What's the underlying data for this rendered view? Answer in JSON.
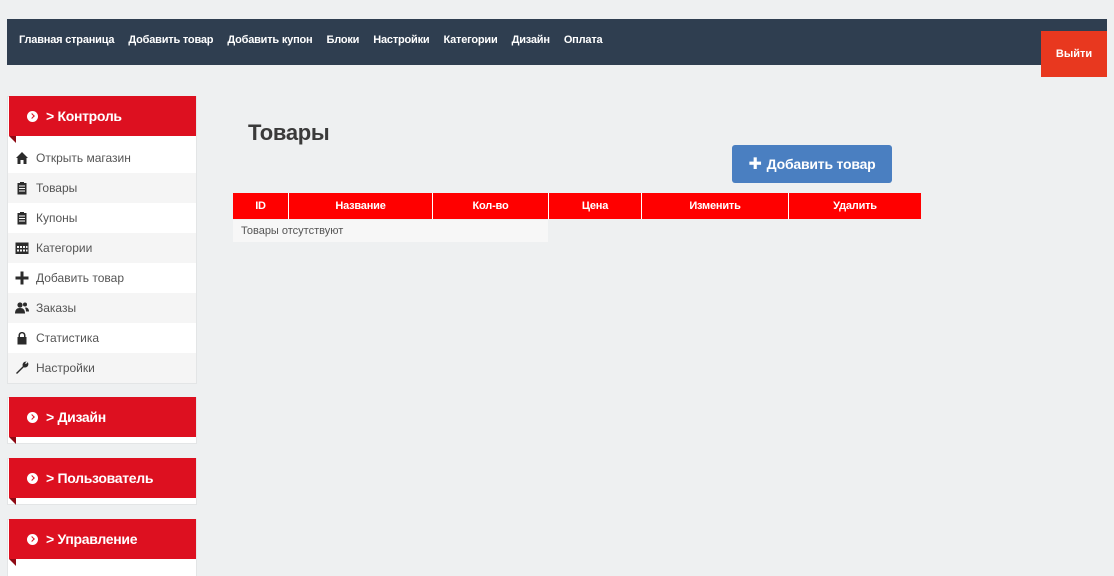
{
  "topnav": {
    "items": [
      "Главная страница",
      "Добавить товар",
      "Добавить купон",
      "Блоки",
      "Настройки",
      "Категории",
      "Дизайн",
      "Оплата"
    ],
    "logout": "Выйти"
  },
  "sidebar": {
    "control": {
      "title": "> Контроль",
      "items": [
        {
          "label": "Открыть магазин",
          "icon": "home-icon"
        },
        {
          "label": "Товары",
          "icon": "clipboard-icon"
        },
        {
          "label": "Купоны",
          "icon": "clipboard-icon"
        },
        {
          "label": "Категории",
          "icon": "calendar-icon"
        },
        {
          "label": "Добавить товар",
          "icon": "plus-icon"
        },
        {
          "label": "Заказы",
          "icon": "users-icon"
        },
        {
          "label": "Статистика",
          "icon": "lock-icon"
        },
        {
          "label": "Настройки",
          "icon": "wrench-icon"
        }
      ]
    },
    "design": {
      "title": "> Дизайн"
    },
    "user": {
      "title": "> Пользователь"
    },
    "manage": {
      "title": "> Управление"
    }
  },
  "main": {
    "title": "Товары",
    "add_button": "Добавить товар",
    "table": {
      "headers": [
        "ID",
        "Название",
        "Кол-во",
        "Цена",
        "Изменить",
        "Удалить"
      ],
      "empty_text": "Товары отсутствуют"
    }
  },
  "colors": {
    "topbar": "#2f3e50",
    "accent_red": "#dd1020",
    "logout": "#e8381f",
    "button_blue": "#4a7fc1",
    "table_header": "#ff0000"
  }
}
